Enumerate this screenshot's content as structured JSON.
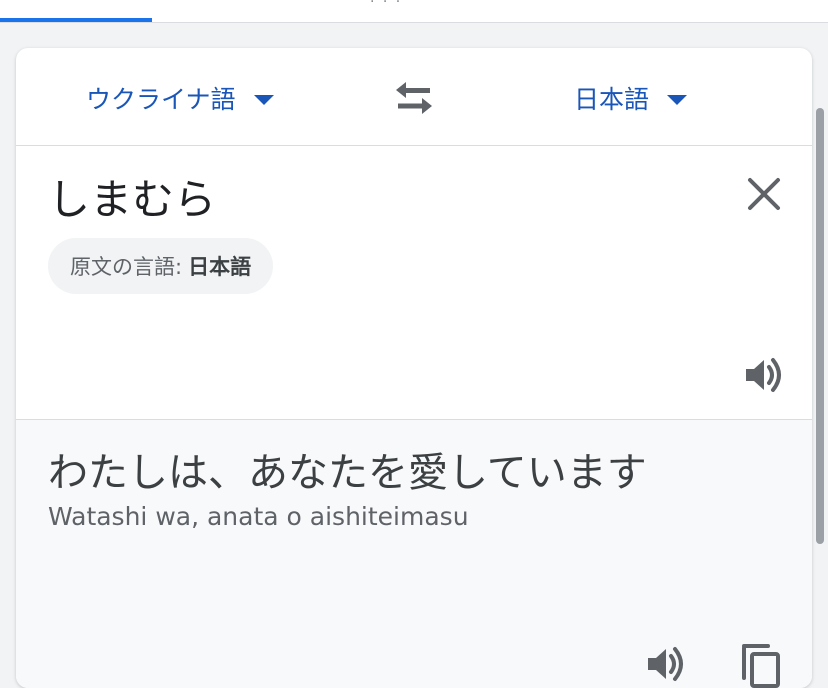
{
  "header": {
    "tab_hint": "· · ·"
  },
  "languages": {
    "source": "ウクライナ語",
    "target": "日本語"
  },
  "source": {
    "text": "しまむら",
    "detected_prefix": "原文の言語:",
    "detected_language": "日本語"
  },
  "translation": {
    "text": "わたしは、あなたを愛しています",
    "transliteration": "Watashi wa, anata o aishiteimasu"
  },
  "icons": {
    "swap": "swap-arrows-icon",
    "clear": "close-icon",
    "speaker": "speaker-icon",
    "copy": "copy-icon"
  },
  "colors": {
    "accent": "#1a56b8",
    "icon": "#5f6368"
  }
}
